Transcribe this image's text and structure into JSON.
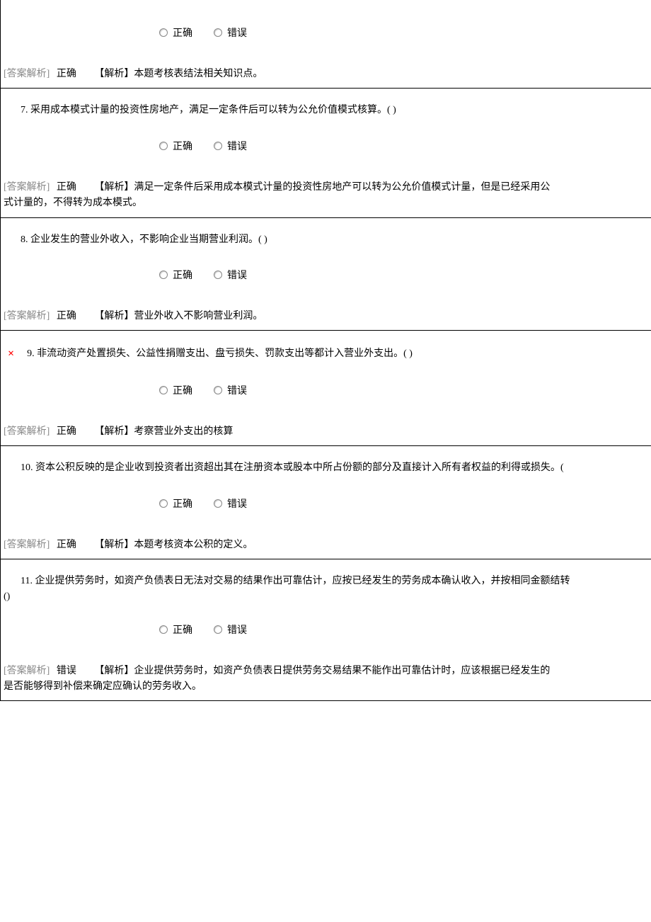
{
  "optionTrue": "正确",
  "optionFalse": "错误",
  "answerLabel": "[答案解析]",
  "q6": {
    "answer": "正确",
    "explanation": "【解析】本题考核表结法相关知识点。"
  },
  "q7": {
    "question": "7. 采用成本模式计量的投资性房地产，满足一定条件后可以转为公允价值模式核算。(    )",
    "answer": "正确",
    "explanation": "【解析】满足一定条件后采用成本模式计量的投资性房地产可以转为公允价值模式计量，但是已经采用公",
    "explanationLine2": "式计量的，不得转为成本模式。"
  },
  "q8": {
    "question": "8. 企业发生的营业外收入，不影响企业当期营业利润。(         )",
    "answer": "正确",
    "explanation": "【解析】营业外收入不影响营业利润。"
  },
  "q9": {
    "marker": "×",
    "question": "9. 非流动资产处置损失、公益性捐赠支出、盘亏损失、罚款支出等都计入营业外支出。(    )",
    "answer": "正确",
    "explanation": "【解析】考察营业外支出的核算"
  },
  "q10": {
    "question": "10. 资本公积反映的是企业收到投资者出资超出其在注册资本或股本中所占份额的部分及直接计入所有者权益的利得或损失。(",
    "answer": "正确",
    "explanation": "【解析】本题考核资本公积的定义。"
  },
  "q11": {
    "questionLine1": "11. 企业提供劳务时，如资产负债表日无法对交易的结果作出可靠估计，应按已经发生的劳务成本确认收入，并按相同金额结转",
    "questionLine2": "()",
    "answer": "错误",
    "explanation": "【解析】企业提供劳务时，如资产负债表日提供劳务交易结果不能作出可靠估计时，应该根据已经发生的",
    "explanationLine2": "是否能够得到补偿来确定应确认的劳务收入。"
  }
}
